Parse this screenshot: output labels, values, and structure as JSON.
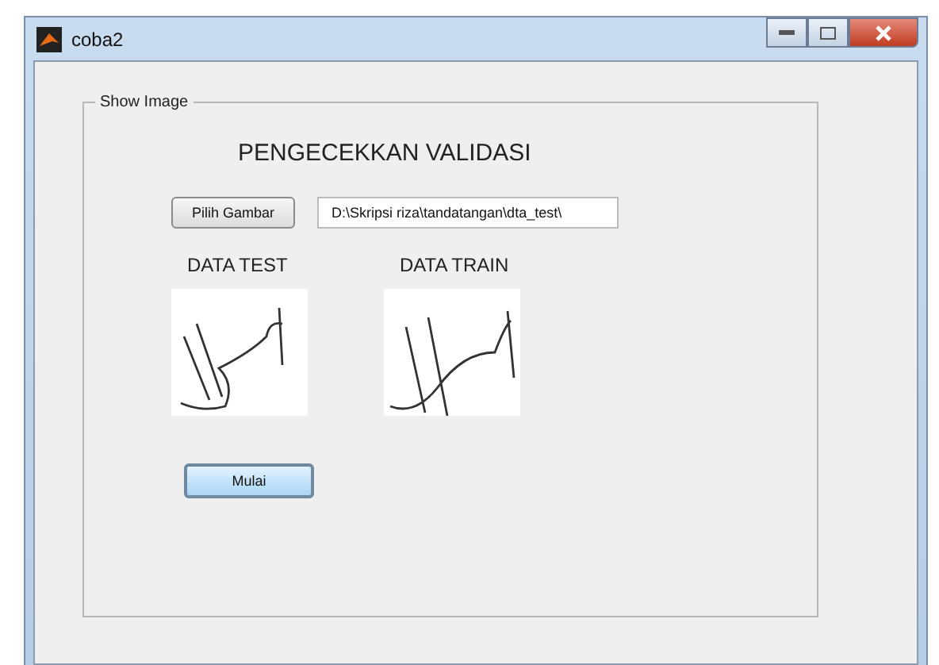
{
  "window": {
    "title": "coba2"
  },
  "panel": {
    "title": "Show Image"
  },
  "heading": "PENGECEKKAN VALIDASI",
  "browse_button": "Pilih Gambar",
  "path_field": {
    "value": "D:\\Skripsi riza\\tandatangan\\dta_test\\"
  },
  "images": [
    {
      "label": "DATA TEST"
    },
    {
      "label": "DATA TRAIN"
    }
  ],
  "start_button": "Mulai"
}
